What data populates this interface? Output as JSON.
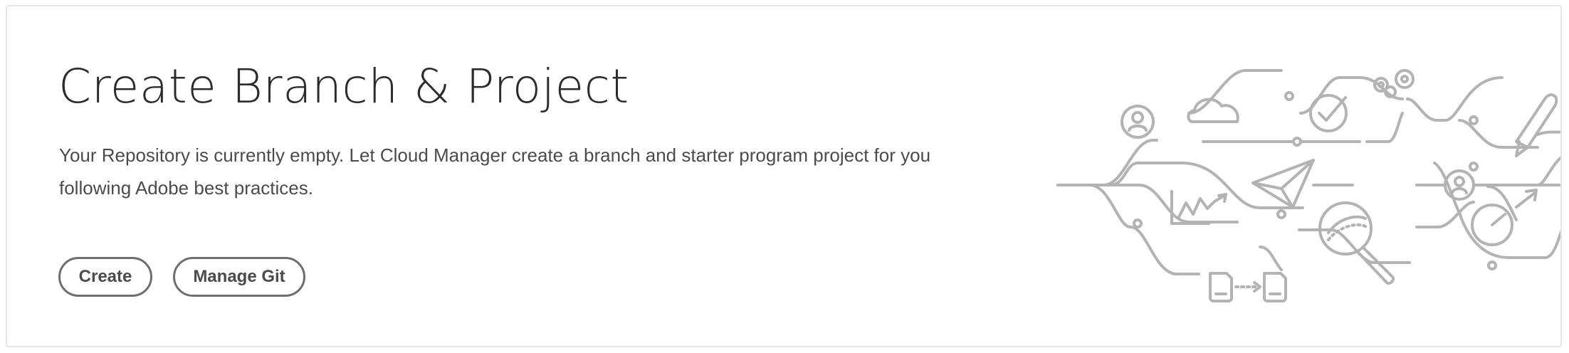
{
  "card": {
    "title": "Create Branch & Project",
    "description": "Your Repository is currently empty. Let Cloud Manager create a branch and starter program project for you following Adobe best practices.",
    "buttons": {
      "create_label": "Create",
      "manage_git_label": "Manage Git"
    }
  },
  "illustration": {
    "icons": [
      "user-icon",
      "cloud-icon",
      "checkmark-icon",
      "gears-icon",
      "pen-icon",
      "paper-plane-icon",
      "chart-icon",
      "user-icon",
      "speedometer-icon",
      "magnifier-icon",
      "document-icon",
      "document-icon"
    ],
    "stroke_color": "#b3b3b3"
  }
}
